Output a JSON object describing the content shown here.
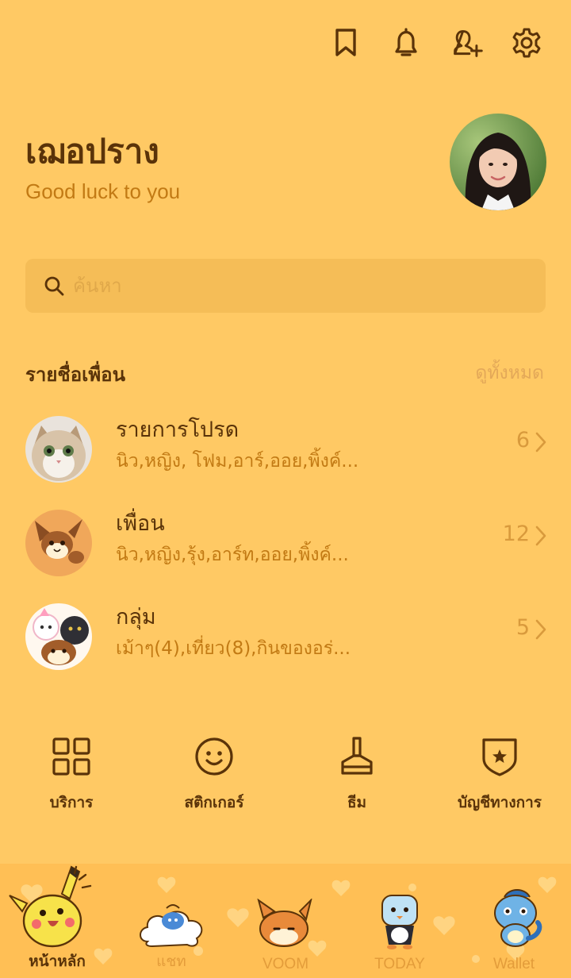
{
  "top_icons": [
    "bookmark-icon",
    "bell-icon",
    "add-friend-icon",
    "gear-icon"
  ],
  "profile": {
    "name": "เฌอปราง",
    "status": "Good luck to you"
  },
  "search": {
    "placeholder": "ค้นหา"
  },
  "friends": {
    "title": "รายชื่อเพื่อน",
    "see_all": "ดูทั้งหมด",
    "rows": [
      {
        "title": "รายการโปรด",
        "members": "นิว,หญิง, โฟม,อาร์,ออย,พิ้งค์...",
        "count": "6"
      },
      {
        "title": "เพื่อน",
        "members": "นิว,หญิง,รุ้ง,อาร์ท,ออย,พิ้งค์...",
        "count": "12"
      },
      {
        "title": "กลุ่ม",
        "members": "เม้าๆ(4),เที่ยว(8),กินของอร่...",
        "count": "5"
      }
    ]
  },
  "quick_menu": [
    {
      "label": "บริการ",
      "icon": "grid-icon"
    },
    {
      "label": "สติกเกอร์",
      "icon": "smiley-icon"
    },
    {
      "label": "ธีม",
      "icon": "brush-icon"
    },
    {
      "label": "บัญชีทางการ",
      "icon": "official-badge-icon"
    }
  ],
  "tabs": [
    {
      "label": "หน้าหลัก",
      "active": true
    },
    {
      "label": "แชท",
      "active": false
    },
    {
      "label": "VOOM",
      "active": false
    },
    {
      "label": "TODAY",
      "active": false
    },
    {
      "label": "Wallet",
      "active": false
    }
  ],
  "colors": {
    "background": "#ffc964",
    "text_dark": "#5a3309",
    "text_accent": "#c27a14",
    "search_bg": "#f5bd57"
  }
}
